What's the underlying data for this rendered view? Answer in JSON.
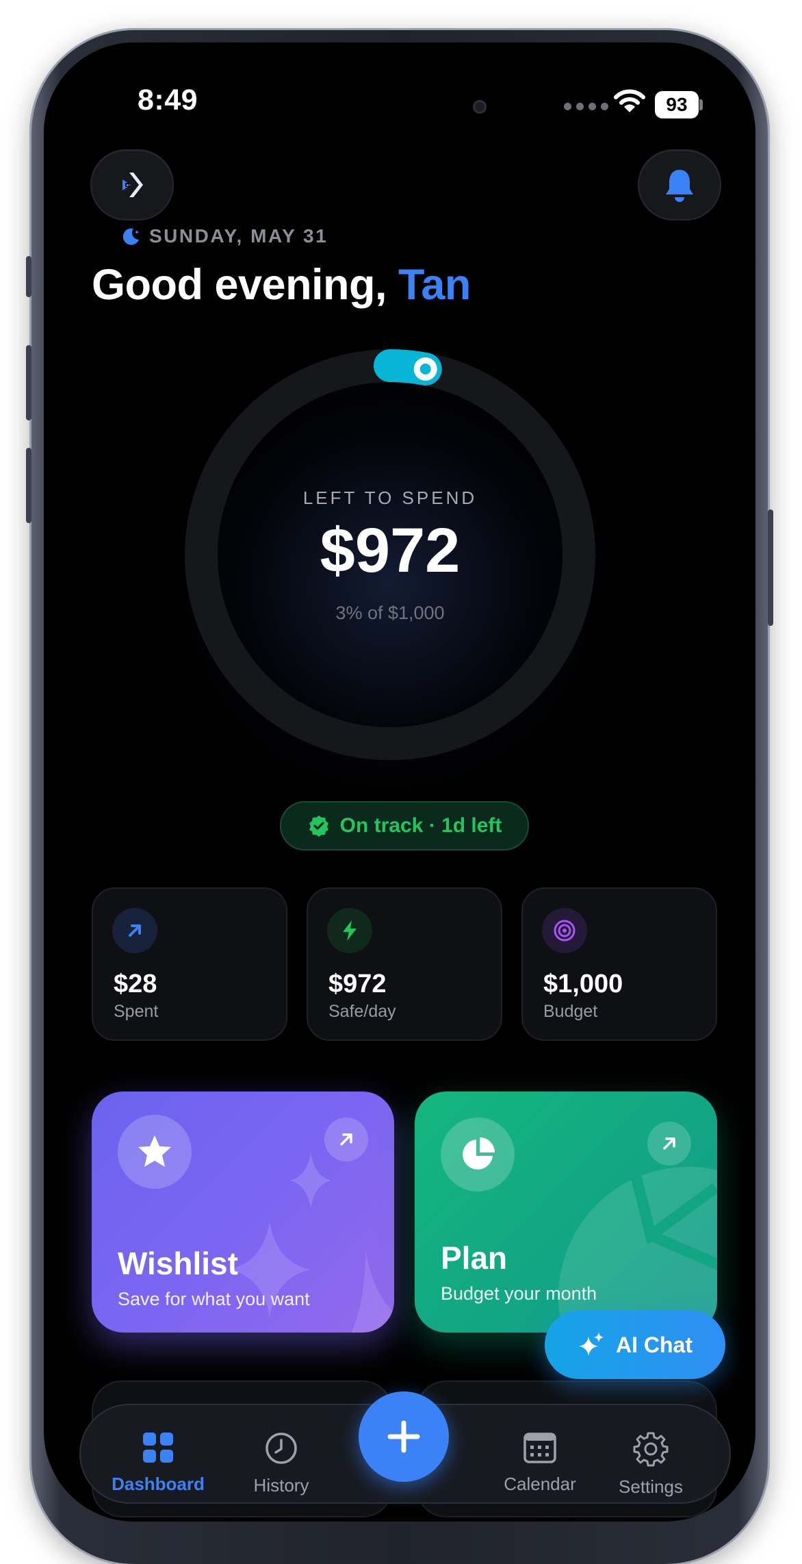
{
  "status_bar": {
    "time": "8:49",
    "battery": "93"
  },
  "header": {
    "date": "SUNDAY, MAY 31",
    "greeting": "Good evening,",
    "user_name": "Tan"
  },
  "budget_ring": {
    "label": "LEFT TO SPEND",
    "amount": "$972",
    "subtext": "3% of $1,000",
    "progress_fraction": 0.03
  },
  "status_pill": {
    "text": "On track · 1d left"
  },
  "stats": [
    {
      "value": "$28",
      "label": "Spent",
      "icon": "arrow-up-right-icon",
      "color": "#3b82f6"
    },
    {
      "value": "$972",
      "label": "Safe/day",
      "icon": "bolt-icon",
      "color": "#22c55e"
    },
    {
      "value": "$1,000",
      "label": "Budget",
      "icon": "target-icon",
      "color": "#a855f7"
    }
  ],
  "features": [
    {
      "title": "Wishlist",
      "subtitle": "Save for what you want",
      "icon": "star-icon",
      "color": "#7c66f1"
    },
    {
      "title": "Plan",
      "subtitle": "Budget your month",
      "icon": "pie-chart-icon",
      "color": "#14b07f"
    }
  ],
  "ai_chat": {
    "label": "AI Chat",
    "icon": "sparkles-icon"
  },
  "tabbar": {
    "items": [
      {
        "label": "Dashboard",
        "icon": "grid-icon",
        "active": true
      },
      {
        "label": "History",
        "icon": "clock-icon",
        "active": false
      },
      {
        "label": "Calendar",
        "icon": "calendar-icon",
        "active": false
      },
      {
        "label": "Settings",
        "icon": "gear-icon",
        "active": false
      }
    ],
    "add_icon": "plus-icon"
  },
  "colors": {
    "accent": "#3b82f6",
    "success": "#22c55e",
    "background": "#000000"
  }
}
